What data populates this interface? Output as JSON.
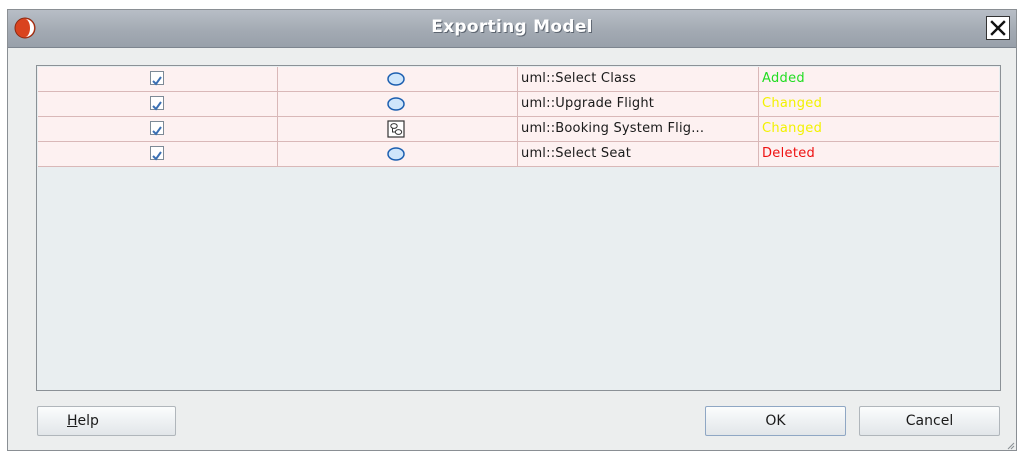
{
  "window": {
    "title": "Exporting Model",
    "icon": "app-logo-icon",
    "close_icon": "close-icon"
  },
  "table": {
    "rows": [
      {
        "checked": true,
        "icon": "use-case-icon",
        "name": "uml::Select Class",
        "status": "Added",
        "status_color": "#22dd22"
      },
      {
        "checked": true,
        "icon": "use-case-icon",
        "name": "uml::Upgrade Flight",
        "status": "Changed",
        "status_color": "#f2f200"
      },
      {
        "checked": true,
        "icon": "use-case-diagram-icon",
        "name": "uml::Booking System Flig...",
        "status": "Changed",
        "status_color": "#f2f200"
      },
      {
        "checked": true,
        "icon": "use-case-icon",
        "name": "uml::Select Seat",
        "status": "Deleted",
        "status_color": "#ee1111"
      }
    ]
  },
  "buttons": {
    "help_mnemonic": "H",
    "help_rest": "elp",
    "ok": "OK",
    "cancel": "Cancel"
  },
  "colors": {
    "title_bar": "#a3aab3",
    "row_bg": "#fdf1f1",
    "panel_bg": "#e9eef0"
  }
}
